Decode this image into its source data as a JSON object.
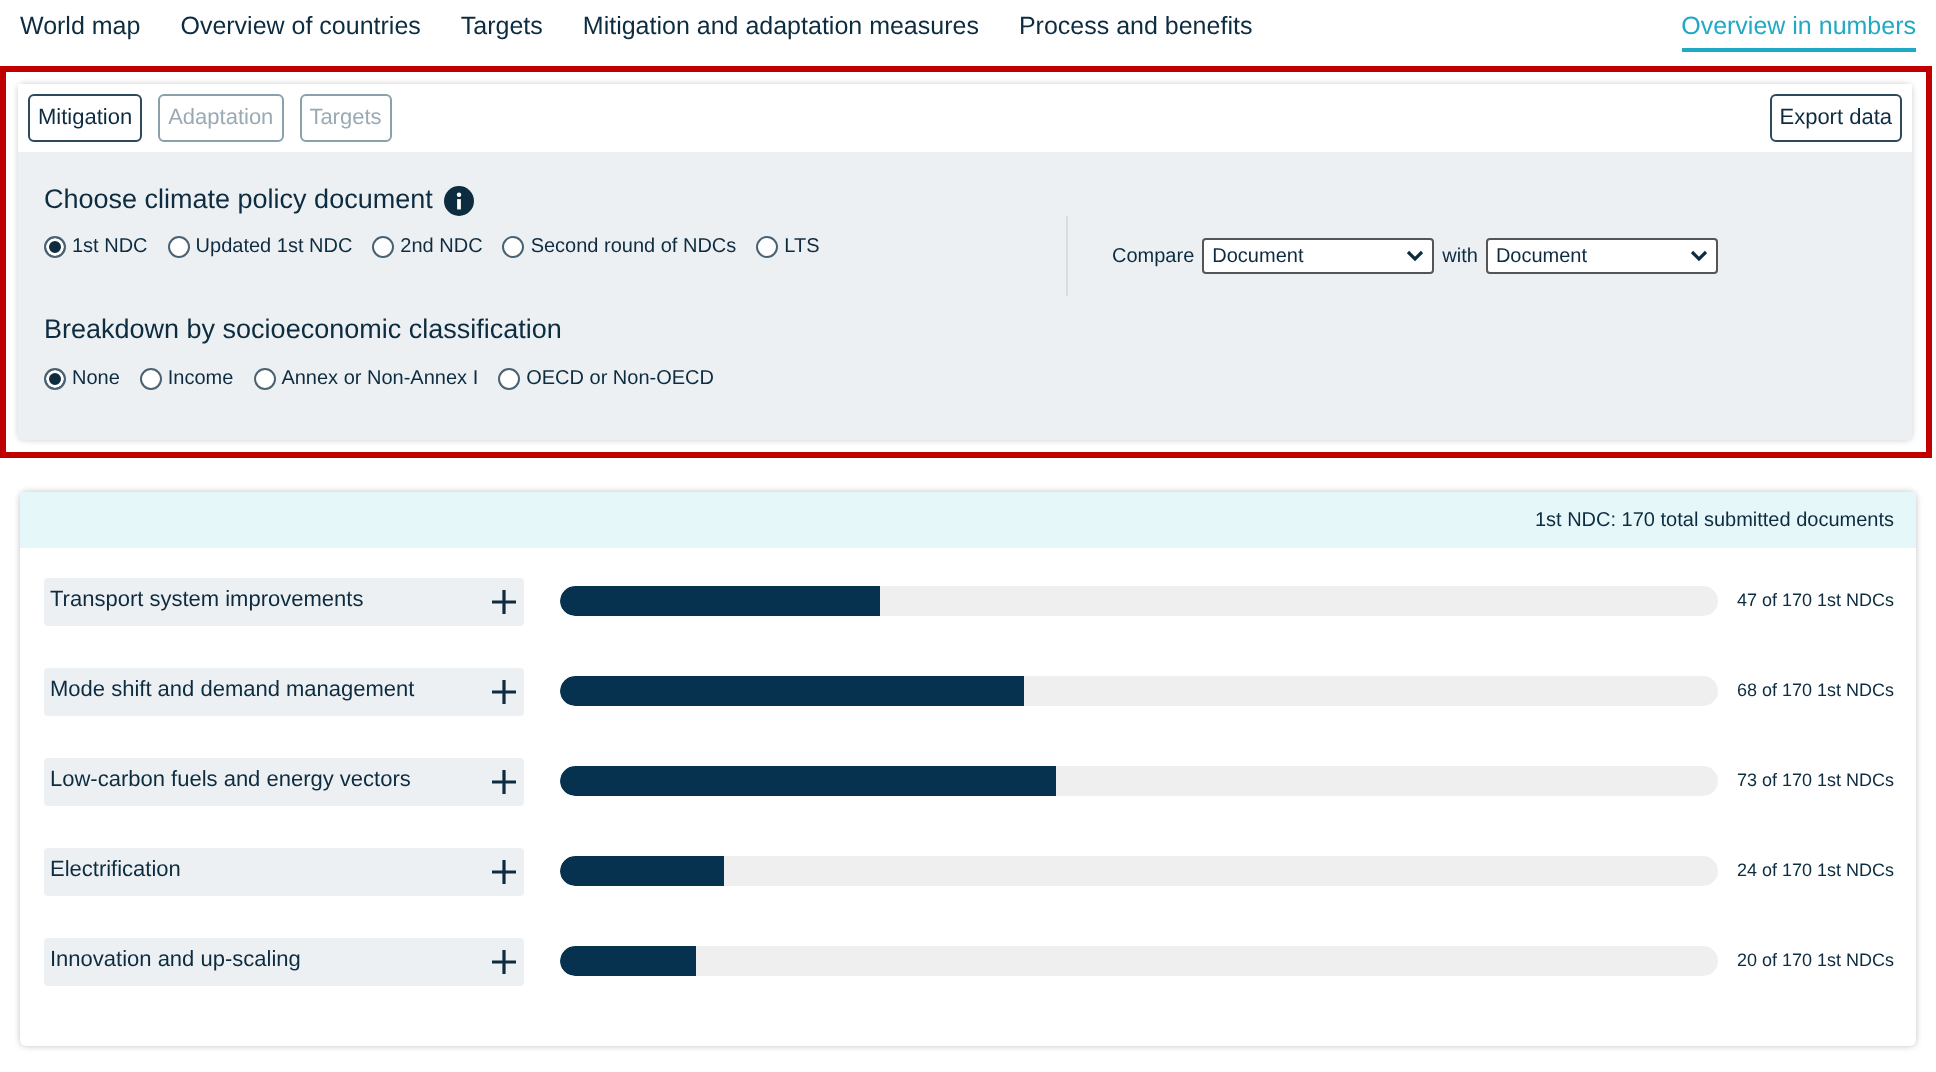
{
  "nav": [
    {
      "label": "World map",
      "selected": false
    },
    {
      "label": "Overview of countries",
      "selected": false
    },
    {
      "label": "Targets",
      "selected": false
    },
    {
      "label": "Mitigation and adaptation measures",
      "selected": false
    },
    {
      "label": "Process and benefits",
      "selected": false
    },
    {
      "label": "Overview in numbers",
      "selected": true
    }
  ],
  "panel": {
    "tabs": [
      {
        "label": "Mitigation",
        "selected": true
      },
      {
        "label": "Adaptation",
        "selected": false
      },
      {
        "label": "Targets",
        "selected": false
      }
    ],
    "export_button": "Export data",
    "document_heading": "Choose climate policy document",
    "documents": [
      {
        "label": "1st NDC",
        "selected": true
      },
      {
        "label": "Updated 1st NDC",
        "selected": false
      },
      {
        "label": "2nd NDC",
        "selected": false
      },
      {
        "label": "Second round of NDCs",
        "selected": false
      },
      {
        "label": "LTS",
        "selected": false
      }
    ],
    "compare": {
      "label": "Compare",
      "first": "Document",
      "with_label": "with",
      "second": "Document"
    },
    "breakdown_heading": "Breakdown by socioeconomic classification",
    "breakdowns": [
      {
        "label": "None",
        "selected": true
      },
      {
        "label": "Income",
        "selected": false
      },
      {
        "label": "Annex or Non-Annex I",
        "selected": false
      },
      {
        "label": "OECD or Non-OECD",
        "selected": false
      }
    ]
  },
  "results": {
    "summary": "1st NDC: 170 total submitted documents",
    "rows": [
      {
        "label": "Transport system improvements",
        "level": 0.276,
        "count": "47 of 170 1st NDCs"
      },
      {
        "label": "Mode shift and demand management",
        "level": 0.4,
        "count": "68 of 170 1st NDCs"
      },
      {
        "label": "Low-carbon fuels and energy vectors",
        "level": 0.429,
        "count": "73 of 170 1st NDCs"
      },
      {
        "label": "Electrification",
        "level": 0.141,
        "count": "24 of 170 1st NDCs"
      },
      {
        "label": "Innovation and up-scaling",
        "level": 0.118,
        "count": "20 of 170 1st NDCs"
      }
    ]
  }
}
